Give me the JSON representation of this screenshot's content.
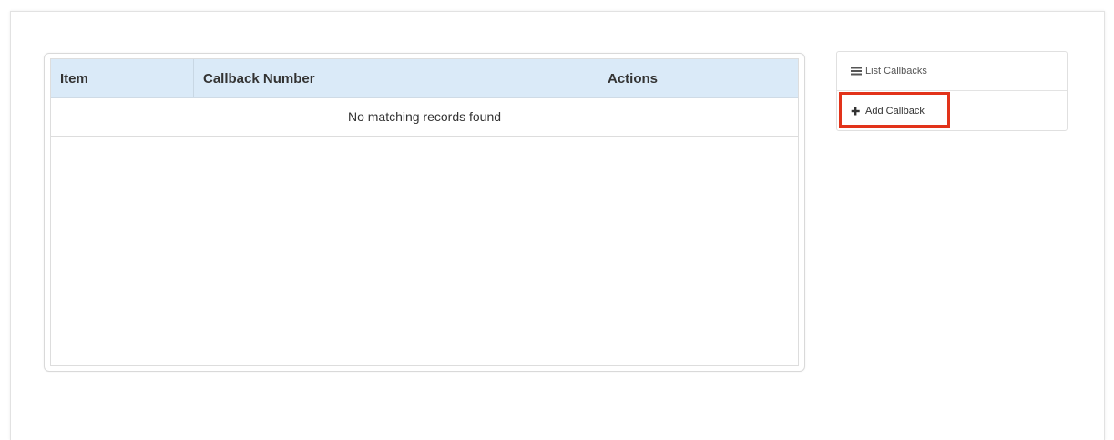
{
  "table": {
    "columns": [
      "Item",
      "Callback Number",
      "Actions"
    ],
    "empty_message": "No matching records found"
  },
  "side_menu": {
    "items": [
      {
        "label": "List Callbacks",
        "icon": "list-icon"
      },
      {
        "label": "Add Callback",
        "icon": "plus-icon"
      }
    ],
    "highlight_color": "#e2331a"
  },
  "colors": {
    "header_bg": "#daeaf8"
  }
}
